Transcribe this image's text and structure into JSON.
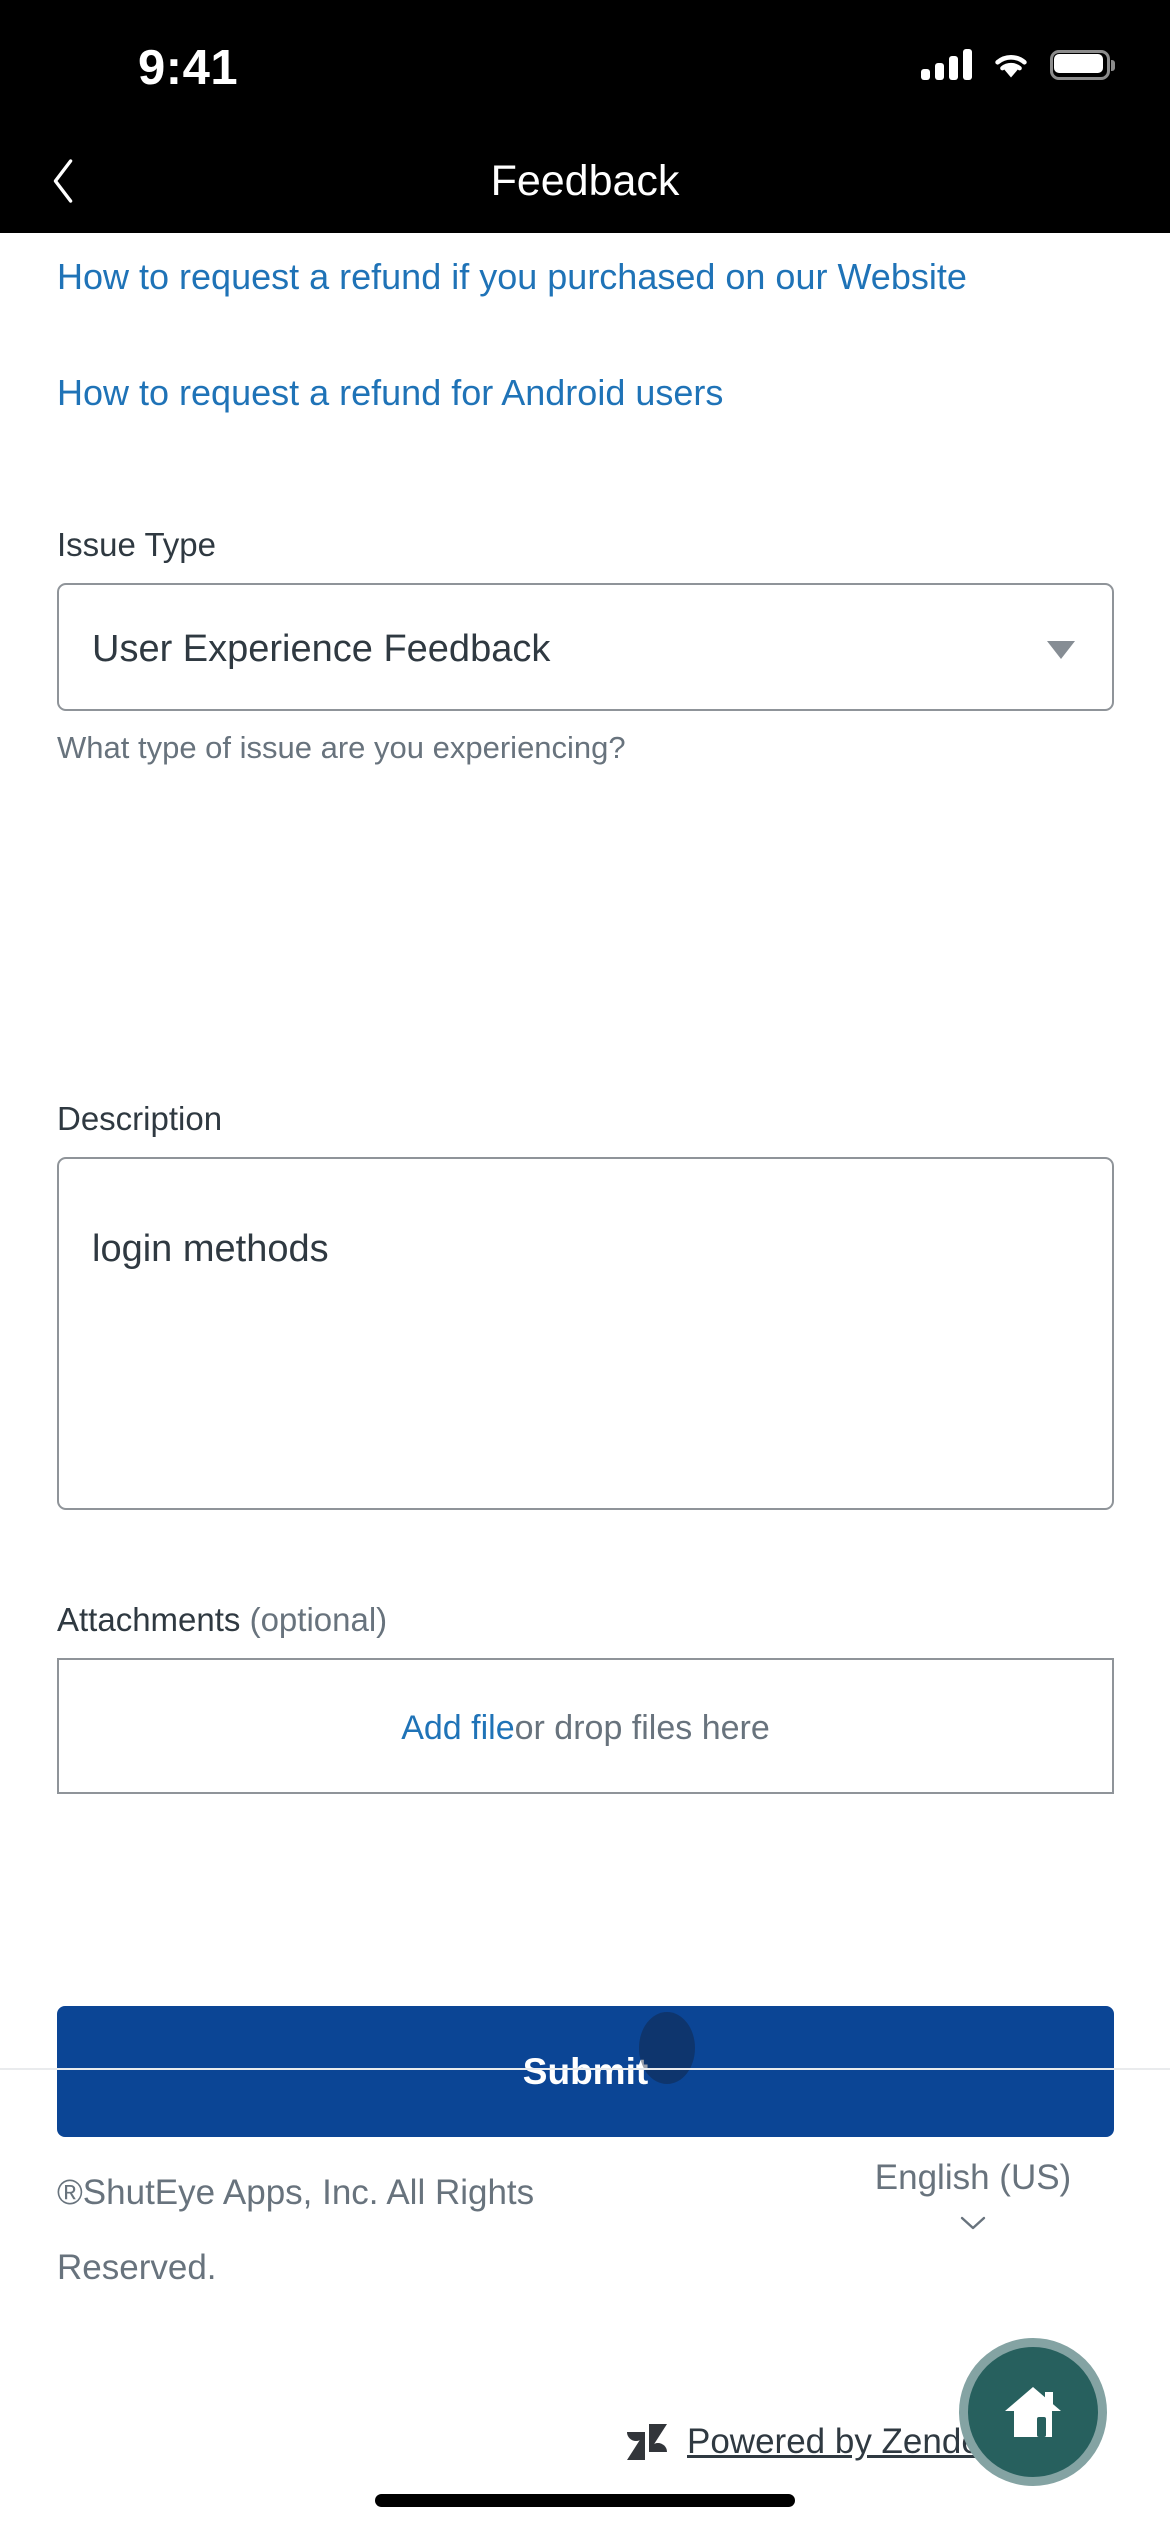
{
  "status_bar": {
    "time": "9:41",
    "icons": [
      "cellular-signal-icon",
      "wifi-icon",
      "battery-icon"
    ],
    "signal_bars": 4,
    "battery_level": "full"
  },
  "nav": {
    "back_icon": "chevron-left-icon",
    "title": "Feedback"
  },
  "help_links": [
    {
      "label": "How to request a refund if you purchased on our Website"
    },
    {
      "label": "How to request a refund for Android users"
    }
  ],
  "form": {
    "issue_type": {
      "label": "Issue Type",
      "value": "User Experience Feedback",
      "hint": "What type of issue are you experiencing?",
      "caret_icon": "triangle-down-icon"
    },
    "description": {
      "label": "Description",
      "value": "login methods",
      "placeholder": ""
    },
    "attachments": {
      "label": "Attachments",
      "optional_label": " (optional)",
      "add_file_label": "Add file",
      "drop_hint_label": " or drop files here"
    },
    "submit_label": "Submit"
  },
  "footer": {
    "copyright": "®ShutEye Apps, Inc. All Rights Reserved.",
    "locale": "English (US)",
    "locale_caret_icon": "chevron-down-icon",
    "powered_by": "Powered by Zendesk",
    "zendesk_logo_icon": "zendesk-logo-icon"
  },
  "fab": {
    "icon": "home-icon",
    "label": "Home"
  },
  "colors": {
    "link_blue": "#1f73b7",
    "submit_blue": "#0b4595",
    "fab_teal": "#27605e",
    "fab_ring": "#84a3a3",
    "text_dark": "#2f3941",
    "text_muted": "#68737d",
    "border_gray": "#8f9499",
    "statusbar_black": "#000000"
  }
}
